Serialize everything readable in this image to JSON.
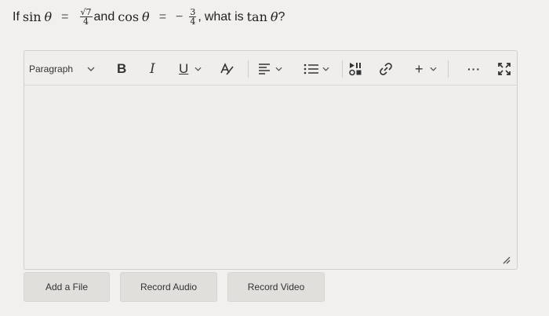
{
  "question": {
    "prefix": "If",
    "sin": "sin",
    "cos": "cos",
    "tan": "tan",
    "theta": "θ",
    "equals": "=",
    "sin_num": "√7",
    "sin_den": "4",
    "and": "and",
    "neg": "−",
    "cos_num": "3",
    "cos_den": "4",
    "comma": ",",
    "what_is": "what is",
    "qmark": "?"
  },
  "toolbar": {
    "paragraph_label": "Paragraph",
    "bold_label": "B",
    "italic_label": "I",
    "underline_label": "U",
    "plus_label": "+",
    "more_label": "···"
  },
  "editor": {
    "content": ""
  },
  "actions": {
    "add_file": "Add a File",
    "record_audio": "Record Audio",
    "record_video": "Record Video"
  },
  "colors": {
    "background": "#f1f0ee",
    "button_bg": "#e0dfdc",
    "border": "#cfcfcd",
    "text": "#1f1f1f"
  }
}
